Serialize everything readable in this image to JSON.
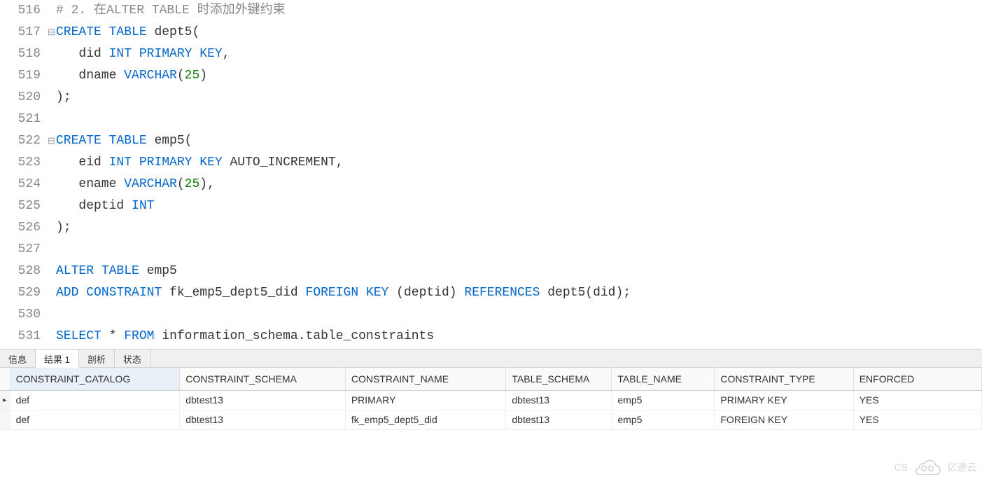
{
  "editor": {
    "lines": [
      {
        "num": "516",
        "fold": "",
        "tokens": [
          [
            "comment",
            "# 2. 在ALTER TABLE 时添加外键约束"
          ]
        ]
      },
      {
        "num": "517",
        "fold": "⊟",
        "tokens": [
          [
            "kw",
            "CREATE"
          ],
          [
            "op",
            " "
          ],
          [
            "kw",
            "TABLE"
          ],
          [
            "op",
            " "
          ],
          [
            "id",
            "dept5"
          ],
          [
            "op",
            "("
          ]
        ]
      },
      {
        "num": "518",
        "fold": "",
        "tokens": [
          [
            "op",
            "   "
          ],
          [
            "id",
            "did"
          ],
          [
            "op",
            " "
          ],
          [
            "kw",
            "INT"
          ],
          [
            "op",
            " "
          ],
          [
            "kw",
            "PRIMARY"
          ],
          [
            "op",
            " "
          ],
          [
            "kw",
            "KEY"
          ],
          [
            "op",
            ","
          ]
        ]
      },
      {
        "num": "519",
        "fold": "",
        "tokens": [
          [
            "op",
            "   "
          ],
          [
            "id",
            "dname"
          ],
          [
            "op",
            " "
          ],
          [
            "kw",
            "VARCHAR"
          ],
          [
            "op",
            "("
          ],
          [
            "num",
            "25"
          ],
          [
            "op",
            ")"
          ]
        ]
      },
      {
        "num": "520",
        "fold": "",
        "tokens": [
          [
            "op",
            ");"
          ]
        ]
      },
      {
        "num": "521",
        "fold": "",
        "tokens": []
      },
      {
        "num": "522",
        "fold": "⊟",
        "tokens": [
          [
            "kw",
            "CREATE"
          ],
          [
            "op",
            " "
          ],
          [
            "kw",
            "TABLE"
          ],
          [
            "op",
            " "
          ],
          [
            "id",
            "emp5"
          ],
          [
            "op",
            "("
          ]
        ]
      },
      {
        "num": "523",
        "fold": "",
        "tokens": [
          [
            "op",
            "   "
          ],
          [
            "id",
            "eid"
          ],
          [
            "op",
            " "
          ],
          [
            "kw",
            "INT"
          ],
          [
            "op",
            " "
          ],
          [
            "kw",
            "PRIMARY"
          ],
          [
            "op",
            " "
          ],
          [
            "kw",
            "KEY"
          ],
          [
            "op",
            " "
          ],
          [
            "id",
            "AUTO_INCREMENT"
          ],
          [
            "op",
            ","
          ]
        ]
      },
      {
        "num": "524",
        "fold": "",
        "tokens": [
          [
            "op",
            "   "
          ],
          [
            "id",
            "ename"
          ],
          [
            "op",
            " "
          ],
          [
            "kw",
            "VARCHAR"
          ],
          [
            "op",
            "("
          ],
          [
            "num",
            "25"
          ],
          [
            "op",
            "),"
          ]
        ]
      },
      {
        "num": "525",
        "fold": "",
        "tokens": [
          [
            "op",
            "   "
          ],
          [
            "id",
            "deptid"
          ],
          [
            "op",
            " "
          ],
          [
            "kw",
            "INT"
          ]
        ]
      },
      {
        "num": "526",
        "fold": "",
        "tokens": [
          [
            "op",
            ");"
          ]
        ]
      },
      {
        "num": "527",
        "fold": "",
        "tokens": []
      },
      {
        "num": "528",
        "fold": "",
        "tokens": [
          [
            "kw",
            "ALTER"
          ],
          [
            "op",
            " "
          ],
          [
            "kw",
            "TABLE"
          ],
          [
            "op",
            " "
          ],
          [
            "id",
            "emp5"
          ]
        ]
      },
      {
        "num": "529",
        "fold": "",
        "tokens": [
          [
            "kw",
            "ADD"
          ],
          [
            "op",
            " "
          ],
          [
            "kw",
            "CONSTRAINT"
          ],
          [
            "op",
            " "
          ],
          [
            "id",
            "fk_emp5_dept5_did"
          ],
          [
            "op",
            " "
          ],
          [
            "kw",
            "FOREIGN"
          ],
          [
            "op",
            " "
          ],
          [
            "kw",
            "KEY"
          ],
          [
            "op",
            " ("
          ],
          [
            "id",
            "deptid"
          ],
          [
            "op",
            ") "
          ],
          [
            "kw",
            "REFERENCES"
          ],
          [
            "op",
            " "
          ],
          [
            "id",
            "dept5"
          ],
          [
            "op",
            "("
          ],
          [
            "id",
            "did"
          ],
          [
            "op",
            ");"
          ]
        ]
      },
      {
        "num": "530",
        "fold": "",
        "tokens": []
      },
      {
        "num": "531",
        "fold": "",
        "tokens": [
          [
            "kw",
            "SELECT"
          ],
          [
            "op",
            " "
          ],
          [
            "op",
            "*"
          ],
          [
            "op",
            " "
          ],
          [
            "kw",
            "FROM"
          ],
          [
            "op",
            " "
          ],
          [
            "id",
            "information_schema.table_constraints"
          ]
        ]
      }
    ]
  },
  "tabs": {
    "items": [
      "信息",
      "结果 1",
      "剖析",
      "状态"
    ],
    "active_index": 1
  },
  "results": {
    "columns": [
      "CONSTRAINT_CATALOG",
      "CONSTRAINT_SCHEMA",
      "CONSTRAINT_NAME",
      "TABLE_SCHEMA",
      "TABLE_NAME",
      "CONSTRAINT_TYPE",
      "ENFORCED"
    ],
    "active_column_index": 0,
    "rows": [
      {
        "marker": "▸",
        "cells": [
          "def",
          "dbtest13",
          "PRIMARY",
          "dbtest13",
          "emp5",
          "PRIMARY KEY",
          "YES"
        ]
      },
      {
        "marker": "",
        "cells": [
          "def",
          "dbtest13",
          "fk_emp5_dept5_did",
          "dbtest13",
          "emp5",
          "FOREIGN KEY",
          "YES"
        ]
      }
    ],
    "col_widths": [
      "14px",
      "241px",
      "235px",
      "228px",
      "150px",
      "146px",
      "197px",
      "182px"
    ]
  },
  "watermark": {
    "text_left": "CS",
    "brand": "亿速云"
  }
}
